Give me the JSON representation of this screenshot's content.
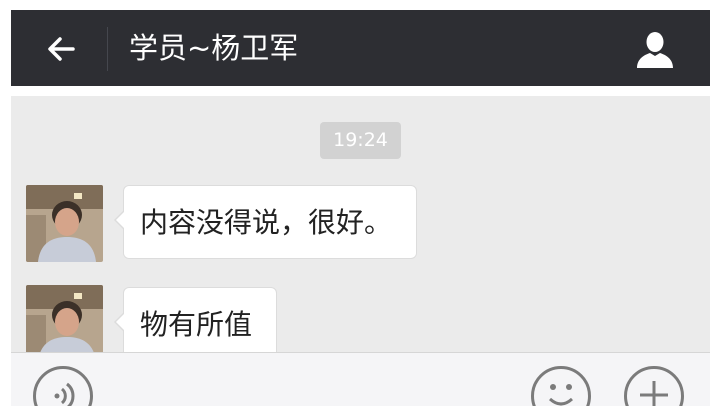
{
  "header": {
    "title": "学员~杨卫军",
    "back_icon": "back-arrow-icon",
    "profile_icon": "person-icon",
    "background_color": "#2d2e33"
  },
  "chat": {
    "background_color": "#ebebeb",
    "timestamp": "19:24",
    "messages": [
      {
        "text": "内容没得说，很好。"
      },
      {
        "text": "物有所值"
      }
    ]
  },
  "input_bar": {
    "voice_icon": "voice-icon",
    "emoji_icon": "emoji-icon",
    "more_icon": "plus-icon"
  }
}
